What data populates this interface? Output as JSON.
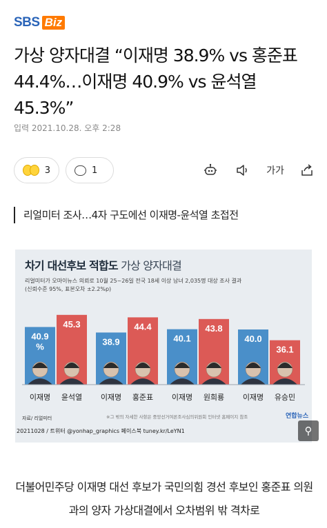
{
  "brand": {
    "name_part1": "SBS",
    "name_part2": "Biz"
  },
  "article": {
    "headline": "가상 양자대결 “이재명 38.9% vs 홍준표 44.4%…이재명 40.9% vs 윤석열 45.3%”",
    "byline": "입력 2021.10.28. 오후 2:28",
    "subhead": "리얼미터 조사…4자 구도에선 이재명-윤석열 초접전",
    "body": "더불어민주당 이재명 대선 후보가 국민의힘 경선 후보인 홍준표 의원과의 양자 가상대결에서 오차범위 밖 격차로"
  },
  "actions": {
    "reaction_count": "3",
    "comment_count": "1",
    "font_label": "가가",
    "icons": [
      "robot-icon",
      "speaker-icon",
      "font-size-icon",
      "share-icon"
    ]
  },
  "figure": {
    "title_bold": "차기 대선후보 적합도",
    "title_rest": " 가상 양자대결",
    "note_line1": "리얼미터가 오마이뉴스 의뢰로 10월 25~26일 전국 18세 이상 남녀 2,035명 대상 조사 결과",
    "note_line2": "(신뢰수준 95%, 표본오차 ±2.2%p)",
    "source": "자료/ 리얼미터",
    "footnote": "※그 밖의 자세한 사항은 중앙선거여론조사심의위원회 인터넷 홈페이지 참조",
    "agency": "연합뉴스",
    "credit": "20211028 / 트위터 @yonhap_graphics 페이스북 tuney.kr/LeYN1"
  },
  "chart_data": {
    "type": "bar",
    "title": "차기 대선후보 적합도 가상 양자대결",
    "groups": [
      {
        "labels": [
          "이재명",
          "윤석열"
        ],
        "values": [
          40.9,
          45.3
        ],
        "value_labels": [
          "40.9\n%",
          "45.3"
        ]
      },
      {
        "labels": [
          "이재명",
          "홍준표"
        ],
        "values": [
          38.9,
          44.4
        ],
        "value_labels": [
          "38.9",
          "44.4"
        ]
      },
      {
        "labels": [
          "이재명",
          "원희룡"
        ],
        "values": [
          40.1,
          43.8
        ],
        "value_labels": [
          "40.1",
          "43.8"
        ]
      },
      {
        "labels": [
          "이재명",
          "유승민"
        ],
        "values": [
          40.0,
          36.1
        ],
        "value_labels": [
          "40.0",
          "36.1"
        ]
      }
    ],
    "colors": {
      "blue": "#4a8fc9",
      "red": "#dc5a56"
    },
    "ylim": [
      0,
      50
    ]
  }
}
